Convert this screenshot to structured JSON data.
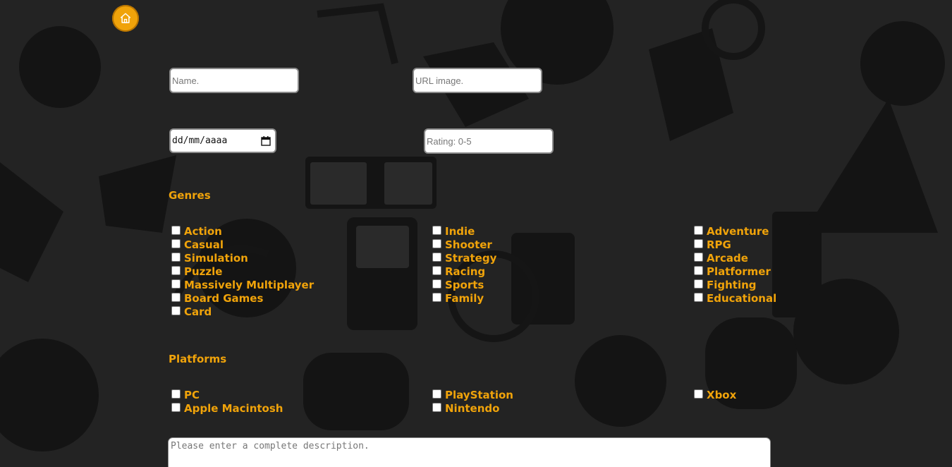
{
  "nav": {
    "home_icon": "home-icon"
  },
  "form": {
    "name_placeholder": "Name.",
    "url_placeholder": "URL image.",
    "date_value": "dd/mm/aaaa",
    "rating_placeholder": "Rating: 0-5",
    "description_placeholder": "Please enter a complete description."
  },
  "genres": {
    "title": "Genres",
    "col1": [
      "Action",
      "Casual",
      "Simulation",
      "Puzzle",
      "Massively Multiplayer",
      "Board Games",
      "Card"
    ],
    "col2": [
      "Indie",
      "Shooter",
      "Strategy",
      "Racing",
      "Sports",
      "Family"
    ],
    "col3": [
      "Adventure",
      "RPG",
      "Arcade",
      "Platformer",
      "Fighting",
      "Educational"
    ]
  },
  "platforms": {
    "title": "Platforms",
    "col1": [
      "PC",
      "Apple Macintosh"
    ],
    "col2": [
      "PlayStation",
      "Nintendo"
    ],
    "col3": [
      "Xbox"
    ]
  },
  "colors": {
    "accent": "#f0a30a",
    "background": "#232323"
  }
}
